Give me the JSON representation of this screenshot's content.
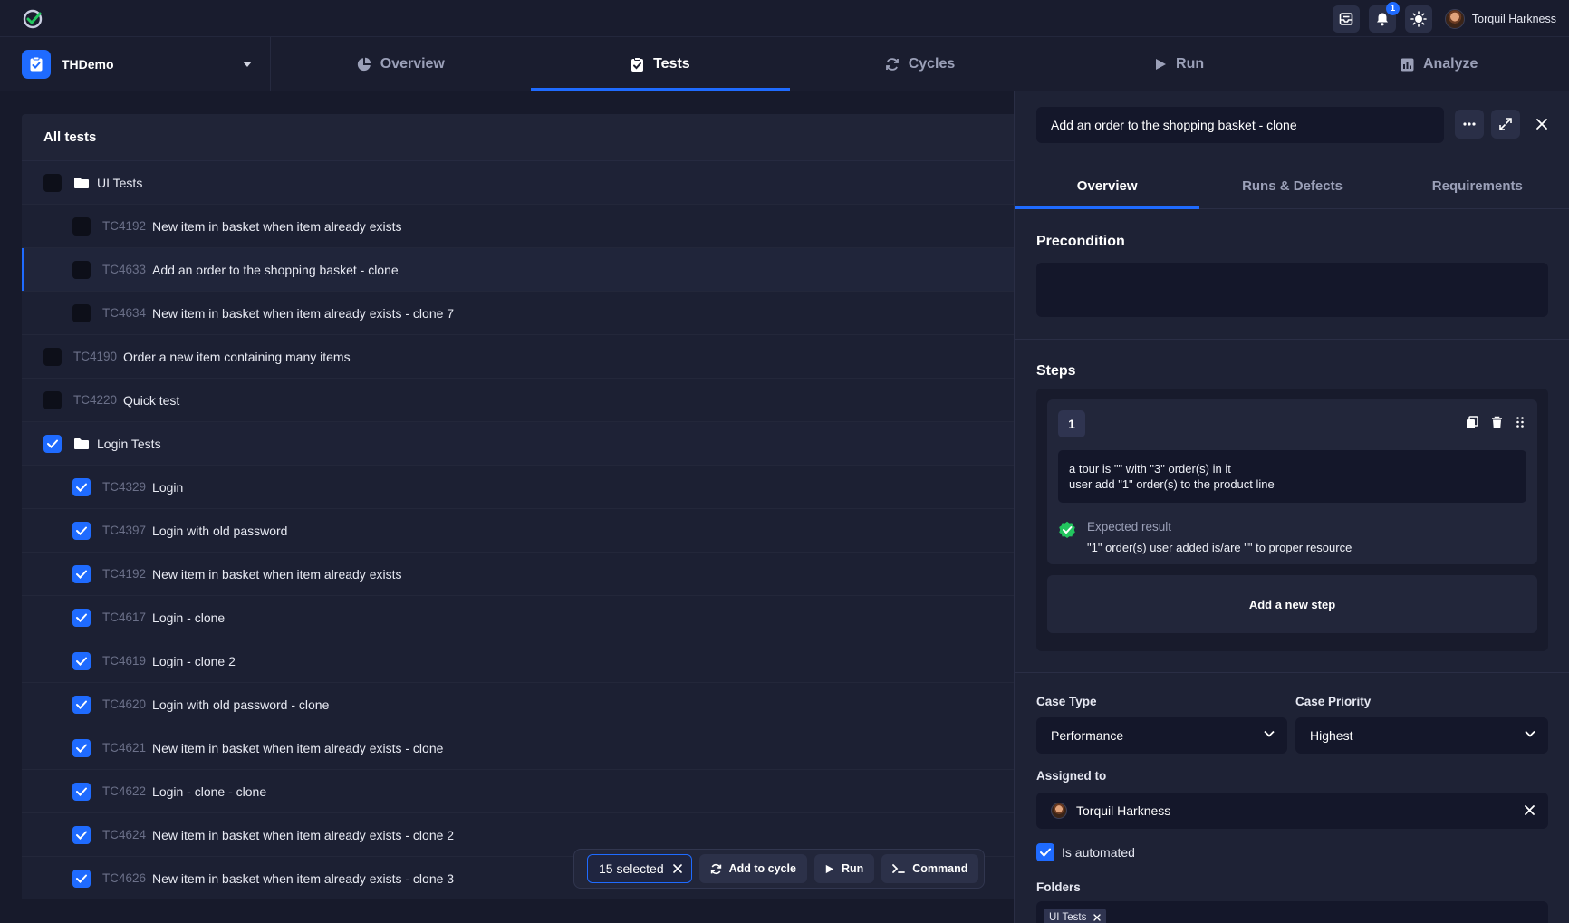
{
  "app": {
    "user_name": "Torquil Harkness",
    "notification_count": "1",
    "accent_color": "#1f6bff",
    "success_color": "#22c55e"
  },
  "project": {
    "name": "THDemo"
  },
  "nav": {
    "tabs": [
      {
        "label": "Overview",
        "icon": "pie-chart-icon"
      },
      {
        "label": "Tests",
        "icon": "clipboard-check-icon",
        "active": true
      },
      {
        "label": "Cycles",
        "icon": "refresh-icon"
      },
      {
        "label": "Run",
        "icon": "play-icon"
      },
      {
        "label": "Analyze",
        "icon": "bar-chart-icon"
      }
    ]
  },
  "tree": {
    "title": "All tests",
    "rows": [
      {
        "type": "folder",
        "level": 0,
        "label": "UI Tests",
        "checked": false
      },
      {
        "type": "test",
        "level": 1,
        "id": "TC4192",
        "name": "New item in basket when item already exists",
        "checked": false
      },
      {
        "type": "test",
        "level": 1,
        "id": "TC4633",
        "name": "Add an order to the shopping basket - clone",
        "checked": false,
        "selected": true
      },
      {
        "type": "test",
        "level": 1,
        "id": "TC4634",
        "name": "New item in basket when item already exists - clone 7",
        "checked": false
      },
      {
        "type": "test",
        "level": 0,
        "id": "TC4190",
        "name": "Order a new item containing many items",
        "checked": false
      },
      {
        "type": "test",
        "level": 0,
        "id": "TC4220",
        "name": "Quick test",
        "checked": false
      },
      {
        "type": "folder",
        "level": 0,
        "label": "Login Tests",
        "checked": true
      },
      {
        "type": "test",
        "level": 1,
        "id": "TC4329",
        "name": "Login",
        "checked": true
      },
      {
        "type": "test",
        "level": 1,
        "id": "TC4397",
        "name": "Login with old password",
        "checked": true
      },
      {
        "type": "test",
        "level": 1,
        "id": "TC4192",
        "name": "New item in basket when item already exists",
        "checked": true
      },
      {
        "type": "test",
        "level": 1,
        "id": "TC4617",
        "name": "Login - clone",
        "checked": true
      },
      {
        "type": "test",
        "level": 1,
        "id": "TC4619",
        "name": "Login - clone 2",
        "checked": true
      },
      {
        "type": "test",
        "level": 1,
        "id": "TC4620",
        "name": "Login with old password - clone",
        "checked": true
      },
      {
        "type": "test",
        "level": 1,
        "id": "TC4621",
        "name": "New item in basket when item already exists - clone",
        "checked": true
      },
      {
        "type": "test",
        "level": 1,
        "id": "TC4622",
        "name": "Login - clone - clone",
        "checked": true
      },
      {
        "type": "test",
        "level": 1,
        "id": "TC4624",
        "name": "New item in basket when item already exists - clone 2",
        "checked": true
      },
      {
        "type": "test",
        "level": 1,
        "id": "TC4626",
        "name": "New item in basket when item already exists - clone 3",
        "checked": true
      }
    ]
  },
  "actionbar": {
    "selected_label": "15 selected",
    "add_to_cycle_label": "Add to cycle",
    "run_label": "Run",
    "command_label": "Command"
  },
  "panel": {
    "title": "Add an order to the shopping basket - clone",
    "tabs": [
      "Overview",
      "Runs & Defects",
      "Requirements"
    ],
    "precondition_title": "Precondition",
    "steps_title": "Steps",
    "step": {
      "number": "1",
      "line1": "a tour is \"\" with \"3\" order(s) in it",
      "line2": "user add \"1\" order(s) to the product line",
      "expected_label": "Expected result",
      "expected_text": "\"1\" order(s) user added is/are \"\" to proper resource"
    },
    "add_step_label": "Add a new step",
    "case_type_label": "Case Type",
    "case_type_value": "Performance",
    "case_priority_label": "Case Priority",
    "case_priority_value": "Highest",
    "assigned_label": "Assigned to",
    "assigned_value": "Torquil Harkness",
    "automated_label": "Is automated",
    "automated": true,
    "folders_label": "Folders",
    "folder_tag": "UI Tests"
  }
}
